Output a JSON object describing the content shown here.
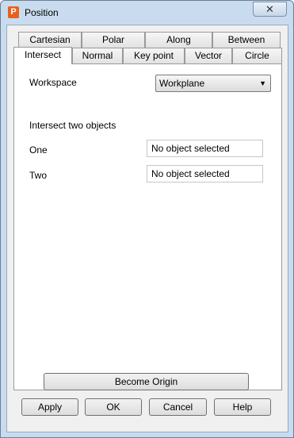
{
  "window": {
    "title": "Position",
    "app_icon_letter": "P",
    "close_label": "✕"
  },
  "tabs": {
    "row1": [
      "Cartesian",
      "Polar",
      "Along",
      "Between"
    ],
    "row2": [
      "Intersect",
      "Normal",
      "Key point",
      "Vector",
      "Circle"
    ],
    "active": "Intersect"
  },
  "form": {
    "workspace_label": "Workspace",
    "workspace_value": "Workplane",
    "section_heading": "Intersect two objects",
    "one_label": "One",
    "one_value": "No object selected",
    "two_label": "Two",
    "two_value": "No object selected"
  },
  "buttons": {
    "become_origin": "Become Origin",
    "apply": "Apply",
    "ok": "OK",
    "cancel": "Cancel",
    "help": "Help"
  },
  "colors": {
    "frame": "#c9dcef",
    "app_icon": "#e8601c"
  }
}
